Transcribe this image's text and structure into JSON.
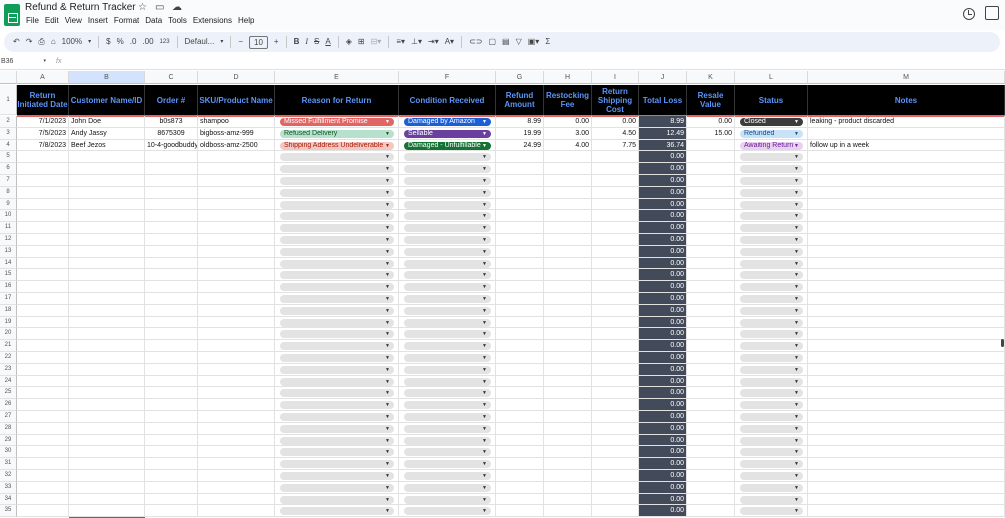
{
  "app": {
    "title": "Refund & Return Tracker",
    "menu": [
      "File",
      "Edit",
      "View",
      "Insert",
      "Format",
      "Data",
      "Tools",
      "Extensions",
      "Help"
    ]
  },
  "toolbar": {
    "zoom": "100%",
    "currency": "$",
    "percent": "%",
    "dec_decrease": ".0",
    "dec_increase": ".00",
    "number_format": "123",
    "font": "Defaul...",
    "font_size": "10",
    "bold": "B",
    "italic": "I",
    "sum": "Σ"
  },
  "formula_bar": {
    "cell_ref": "B36",
    "fx": "fx"
  },
  "sheet": {
    "column_letters": [
      "A",
      "B",
      "C",
      "D",
      "E",
      "F",
      "G",
      "H",
      "I",
      "J",
      "K",
      "L",
      "M"
    ],
    "headers": [
      "Return Initiated Date",
      "Customer Name/ID",
      "Order #",
      "SKU/Product Name",
      "Reason for Return",
      "Condition Received",
      "Refund Amount",
      "Restocking Fee",
      "Return Shipping Cost",
      "Total Loss",
      "Resale Value",
      "Status",
      "Notes"
    ],
    "rows": [
      {
        "num": "2",
        "date": "7/1/2023",
        "customer": "John Doe",
        "order": "b0s873",
        "sku": "shampoo",
        "reason": "Missed Fulfillment Promise",
        "condition": "Damaged by Amazon",
        "refund": "8.99",
        "restock": "0.00",
        "shipping": "0.00",
        "total": "8.99",
        "resale": "0.00",
        "status": "Closed",
        "notes": "leaking - product discarded"
      },
      {
        "num": "3",
        "date": "7/5/2023",
        "customer": "Andy Jassy",
        "order": "8675309",
        "sku": "bigboss-amz-999",
        "reason": "Refused Delivery",
        "condition": "Sellable",
        "refund": "19.99",
        "restock": "3.00",
        "shipping": "4.50",
        "total": "12.49",
        "resale": "15.00",
        "status": "Refunded",
        "notes": ""
      },
      {
        "num": "4",
        "date": "7/8/2023",
        "customer": "Beef Jezos",
        "order": "10-4-goodbuddy",
        "sku": "oldboss-amz-2500",
        "reason": "Shipping Address Undeliverable",
        "condition": "Damaged - Unfulfillable",
        "refund": "24.99",
        "restock": "4.00",
        "shipping": "7.75",
        "total": "36.74",
        "resale": "",
        "status": "Awaiting Return",
        "notes": "follow up in a week"
      }
    ],
    "empty_row_nums": [
      "5",
      "6",
      "7",
      "8",
      "9",
      "10",
      "11",
      "12",
      "13",
      "14",
      "15",
      "16",
      "17",
      "18",
      "19",
      "20",
      "21",
      "22",
      "23",
      "24",
      "25",
      "26",
      "27",
      "28",
      "29",
      "30",
      "31",
      "32",
      "33",
      "34",
      "35"
    ],
    "empty_total": "0.00"
  },
  "colors": {
    "header_bg": "#000000",
    "header_text": "#5b95f9",
    "total_col_bg": "#434b5a",
    "reason_red": "#e06666",
    "reason_green": "#b7e1cd",
    "condition_blue": "#1c5fd4",
    "condition_purple": "#6a3fa0",
    "condition_green": "#137333",
    "status_closed": "#3c3c3c",
    "status_refunded": "#c9e2f7",
    "status_awaiting": "#e8d0ef"
  }
}
